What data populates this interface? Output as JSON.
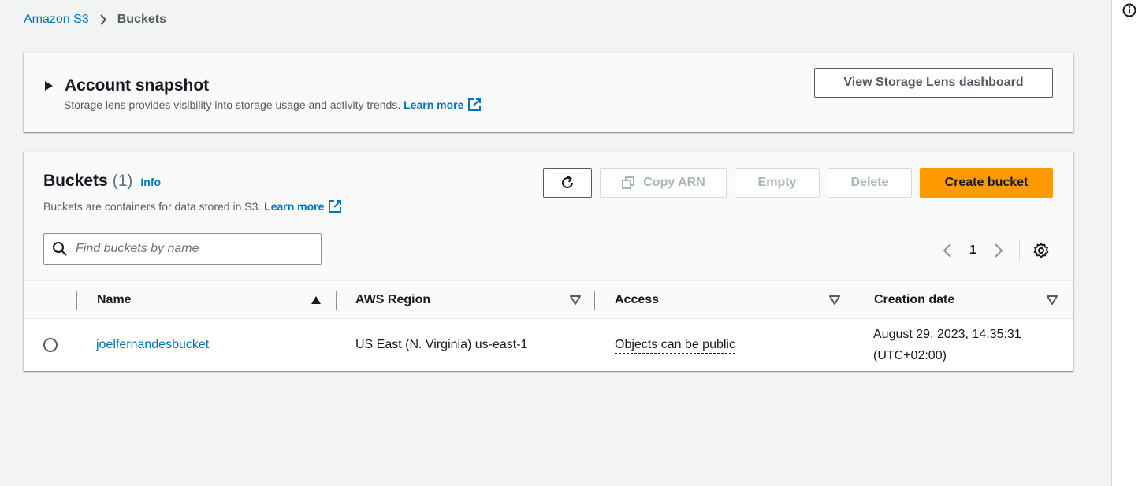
{
  "breadcrumb": {
    "root": "Amazon S3",
    "current": "Buckets"
  },
  "snapshot": {
    "title": "Account snapshot",
    "description": "Storage lens provides visibility into storage usage and activity trends.",
    "learn_more": "Learn more",
    "view_button": "View Storage Lens dashboard"
  },
  "buckets": {
    "title": "Buckets",
    "count": "(1)",
    "info": "Info",
    "description": "Buckets are containers for data stored in S3.",
    "learn_more": "Learn more",
    "actions": {
      "copy_arn": "Copy ARN",
      "empty": "Empty",
      "delete": "Delete",
      "create": "Create bucket"
    },
    "search": {
      "placeholder": "Find buckets by name",
      "value": ""
    },
    "pagination": {
      "current_page": "1"
    },
    "columns": [
      "Name",
      "AWS Region",
      "Access",
      "Creation date"
    ],
    "rows": [
      {
        "name": "joelfernandesbucket",
        "region": "US East (N. Virginia) us-east-1",
        "access": "Objects can be public",
        "created": "August 29, 2023, 14:35:31\n(UTC+02:00)"
      }
    ]
  },
  "colors": {
    "link": "#0073bb",
    "primary": "#ff9900",
    "background": "#f2f3f3"
  },
  "icons": [
    "chevron-right-icon",
    "caret-right-icon",
    "external-link-icon",
    "refresh-icon",
    "copy-icon",
    "search-icon",
    "chevron-left-icon",
    "gear-icon",
    "sort-ascending-icon",
    "sort-descending-icon",
    "info-icon"
  ]
}
